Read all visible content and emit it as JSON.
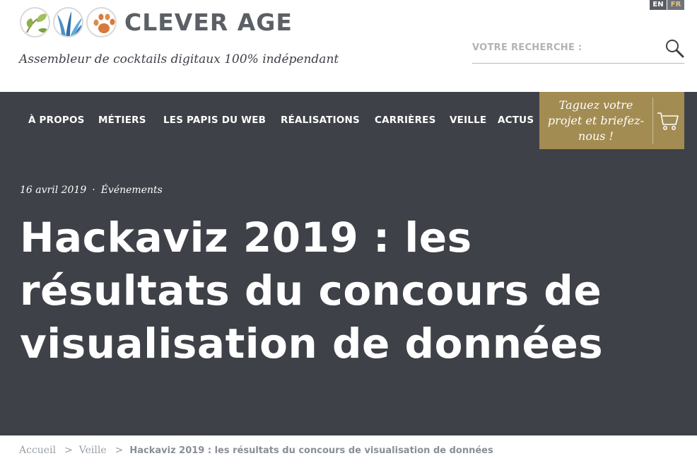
{
  "brand": {
    "name": "CLEVER AGE",
    "tagline": "Assembleur de cocktails digitaux 100% indépendant",
    "colors": {
      "leaf_green": "#8db04a",
      "grass_blue": "#4d7fb0",
      "paw_orange": "#d77a3a",
      "text_gray": "#5b6066"
    }
  },
  "language": {
    "en": "EN",
    "fr": "FR"
  },
  "search": {
    "placeholder": "VOTRE RECHERCHE :",
    "icon": "search-icon"
  },
  "nav": {
    "items": [
      {
        "label": "À PROPOS"
      },
      {
        "label": "MÉTIERS"
      },
      {
        "label": "LES PAPIS DU WEB"
      },
      {
        "label": "RÉALISATIONS"
      },
      {
        "label": "CARRIÈRES"
      },
      {
        "label": "VEILLE"
      },
      {
        "label": "ACTUS"
      }
    ],
    "cta": {
      "line1": "Taguez votre",
      "line2": "projet et briefez-",
      "line3": "nous !",
      "icon": "cart-icon",
      "color": "#a38c52"
    },
    "background": "#3f4148"
  },
  "article": {
    "date": "16 avril 2019",
    "separator": "·",
    "category": "Événements",
    "title": "Hackaviz 2019 : les résultats du concours de visualisation de données"
  },
  "breadcrumb": {
    "items": [
      {
        "label": "Accueil"
      },
      {
        "label": "Veille"
      }
    ],
    "separator": ">",
    "current": "Hackaviz 2019 : les résultats du concours de visualisation de données"
  }
}
